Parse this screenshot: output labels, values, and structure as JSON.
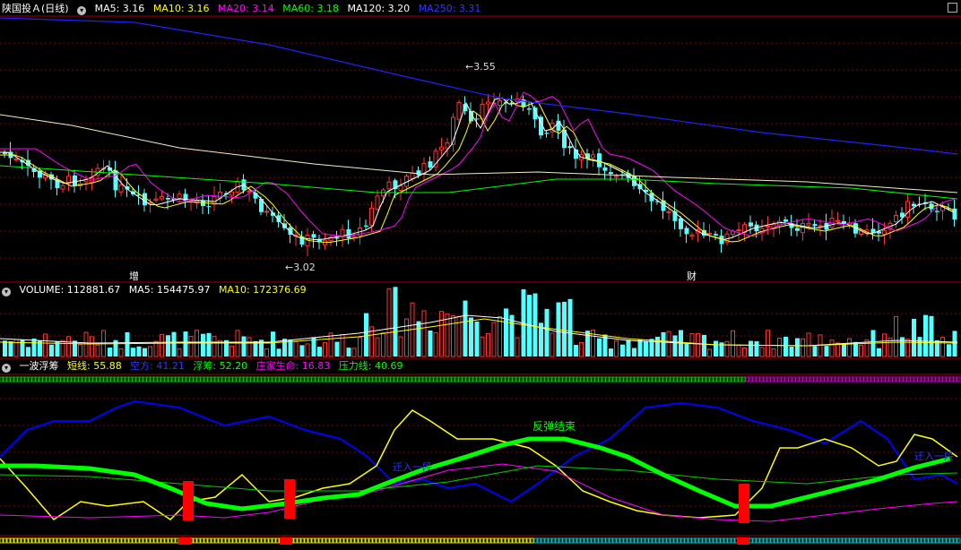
{
  "header1": {
    "title": "陕国投Ａ(日线)",
    "ma": [
      {
        "label": "MA5: 3.16",
        "color": "#ffffff"
      },
      {
        "label": "MA10: 3.16",
        "color": "#ffff00"
      },
      {
        "label": "MA20: 3.14",
        "color": "#ff00ff"
      },
      {
        "label": "MA60: 3.18",
        "color": "#00ff00"
      },
      {
        "label": "MA120: 3.20",
        "color": "#ffffff"
      },
      {
        "label": "MA250: 3.31",
        "color": "#0000ff"
      }
    ]
  },
  "header2": {
    "items": [
      {
        "label": "VOLUME: 112881.67",
        "color": "#ffffff"
      },
      {
        "label": "MA5: 154475.97",
        "color": "#ffffff"
      },
      {
        "label": "MA10: 172376.69",
        "color": "#ffff00"
      }
    ]
  },
  "header3": {
    "items": [
      {
        "label": "一波浮筹",
        "color": "#ffffff"
      },
      {
        "label": "短线: 55.88",
        "color": "#ffff00"
      },
      {
        "label": "空方: 41.21",
        "color": "#0000ff"
      },
      {
        "label": "浮筹: 52.20",
        "color": "#00ff00"
      },
      {
        "label": "庄家生命: 16.83",
        "color": "#ff00ff"
      },
      {
        "label": "压力线: 40.69",
        "color": "#00ff00"
      }
    ]
  },
  "annotations": {
    "high_label": "3.55",
    "low_label": "3.02",
    "marker_zeng": "增",
    "marker_cai": "财",
    "text_fantan": "反弹结束",
    "text_qianru1": "迁入一段",
    "text_qianru2": "迁入一段"
  },
  "colors": {
    "up": "#ff3232",
    "down": "#54ffff",
    "grid": "#800000",
    "ma250": "#2020ff"
  }
}
